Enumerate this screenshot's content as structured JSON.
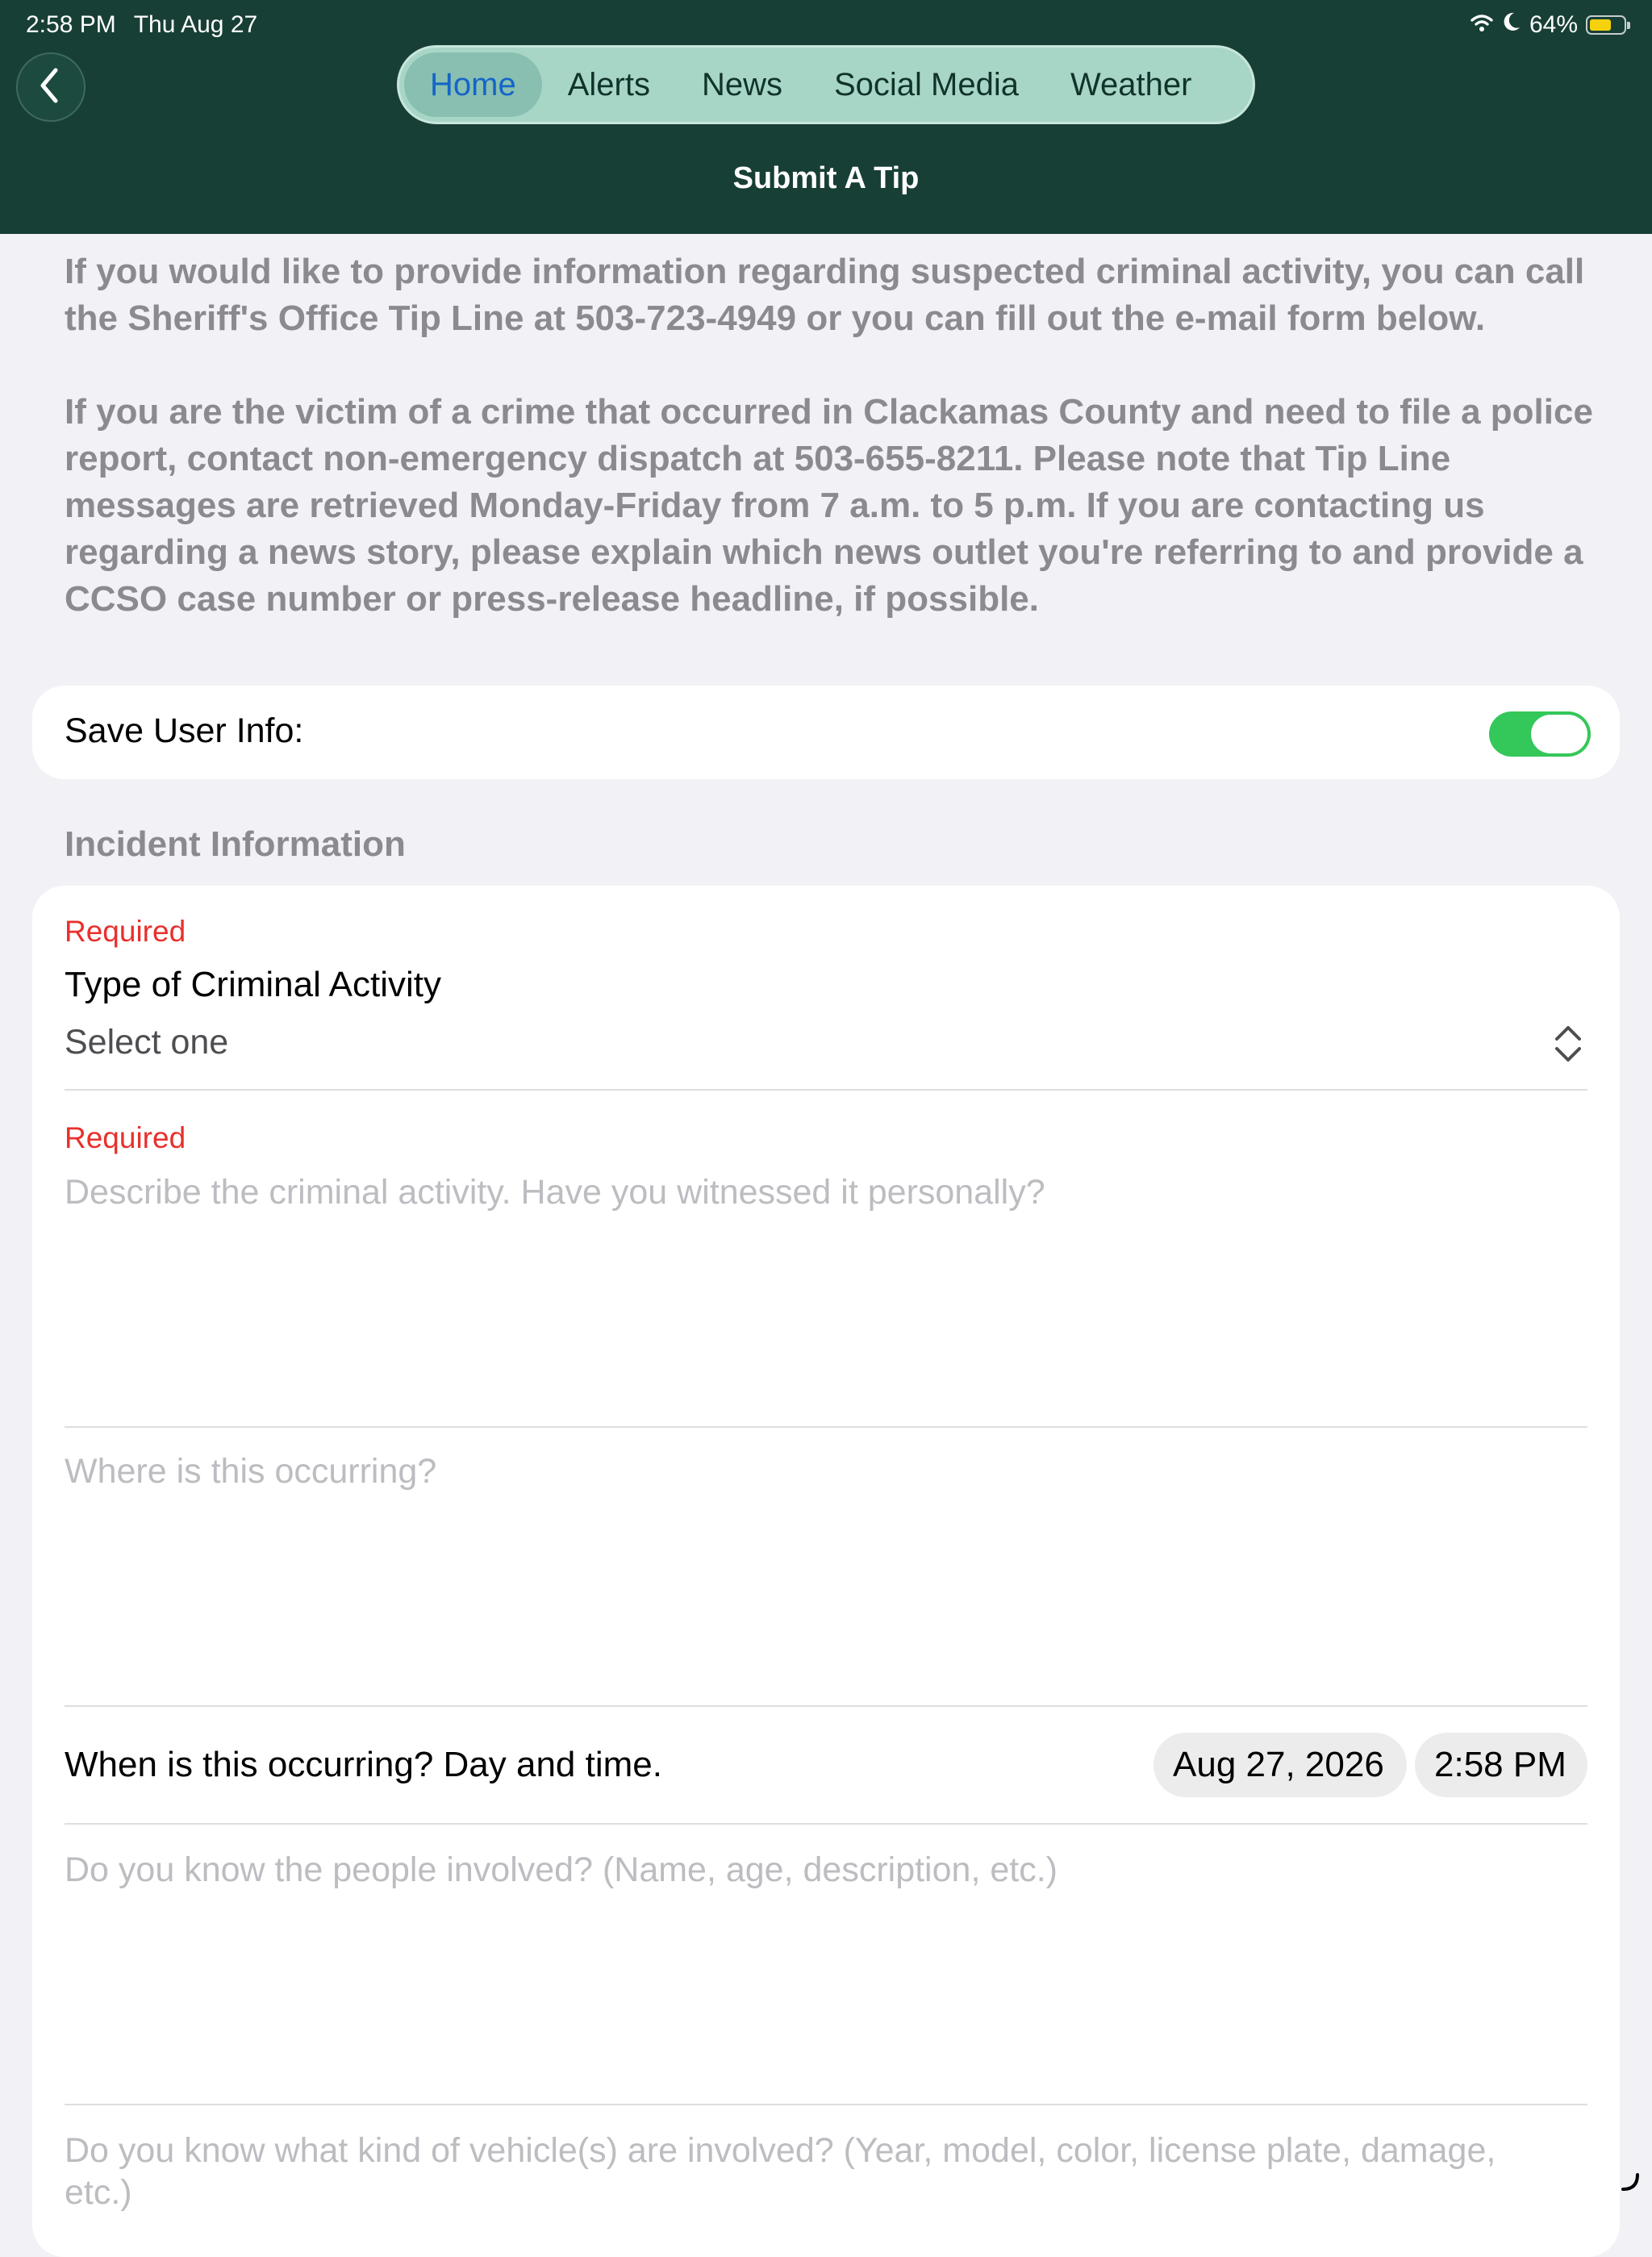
{
  "status_bar": {
    "time": "2:58 PM",
    "date": "Thu Aug 27",
    "battery": "64%",
    "battery_level": 0.64
  },
  "nav": {
    "tabs": [
      {
        "label": "Home",
        "active": true
      },
      {
        "label": "Alerts"
      },
      {
        "label": "News"
      },
      {
        "label": "Social Media"
      },
      {
        "label": "Weather"
      }
    ],
    "title": "Submit A Tip"
  },
  "intro": {
    "paragraph1": "If you would like to provide information regarding suspected criminal activity, you can call the Sheriff's Office Tip Line at 503-723-4949 or you can fill out the e-mail form below.",
    "paragraph2": "If you are the victim of a crime that occurred in Clackamas County and need to file a police report, contact non-emergency dispatch at 503-655-8211. Please note that Tip Line messages are retrieved Monday-Friday from 7 a.m. to 5 p.m. If you are contacting us regarding a news story, please explain which news outlet you're referring to and provide a CCSO case number or press-release headline, if possible."
  },
  "save_user_info": {
    "label": "Save User Info:",
    "enabled": true
  },
  "incident": {
    "section_title": "Incident Information",
    "required_label": "Required",
    "type_label": "Type of Criminal Activity",
    "type_value": "Select one",
    "describe_placeholder": "Describe the criminal activity. Have you witnessed it personally?",
    "where_placeholder": "Where is this occurring?",
    "when_label": "When is this occurring? Day and time.",
    "when_date": "Aug 27, 2026",
    "when_time": "2:58 PM",
    "people_placeholder": "Do you know the people involved? (Name, age, description, etc.)",
    "vehicle_placeholder": "Do you know what kind of vehicle(s) are involved? (Year, model, color, license plate, damage, etc.)"
  },
  "colors": {
    "header_bg": "#183f36",
    "tab_bar_bg": "#a8d6c6",
    "active_tab_text": "#1565c8",
    "required_text": "#e8302c",
    "toggle_on": "#34c759"
  }
}
